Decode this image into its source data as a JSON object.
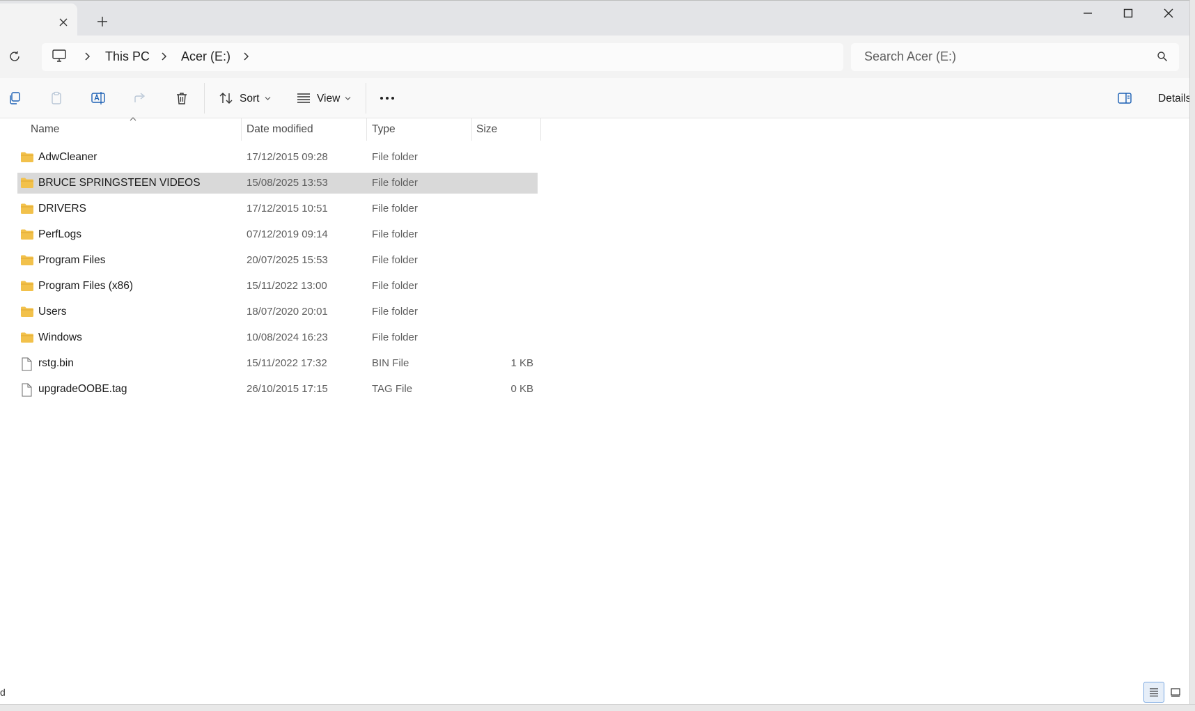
{
  "window": {
    "tab_close_icon": "close-icon",
    "new_tab_icon": "plus-icon",
    "minimize_icon": "minimize-icon",
    "maximize_icon": "maximize-icon",
    "close_icon": "close-icon"
  },
  "address": {
    "refresh_icon": "refresh-icon",
    "computer_icon": "computer-icon",
    "crumbs": [
      "This PC",
      "Acer (E:)"
    ],
    "search_placeholder": "Search Acer (E:)"
  },
  "toolbar": {
    "sort_label": "Sort",
    "view_label": "View",
    "details_label": "Details"
  },
  "columns": {
    "name": "Name",
    "date": "Date modified",
    "type": "Type",
    "size": "Size"
  },
  "files": [
    {
      "name": "AdwCleaner",
      "date": "17/12/2015 09:28",
      "type": "File folder",
      "size": "",
      "kind": "folder"
    },
    {
      "name": "BRUCE SPRINGSTEEN VIDEOS",
      "date": "15/08/2025 13:53",
      "type": "File folder",
      "size": "",
      "kind": "folder",
      "selected": true
    },
    {
      "name": "DRIVERS",
      "date": "17/12/2015 10:51",
      "type": "File folder",
      "size": "",
      "kind": "folder"
    },
    {
      "name": "PerfLogs",
      "date": "07/12/2019 09:14",
      "type": "File folder",
      "size": "",
      "kind": "folder"
    },
    {
      "name": "Program Files",
      "date": "20/07/2025 15:53",
      "type": "File folder",
      "size": "",
      "kind": "folder"
    },
    {
      "name": "Program Files (x86)",
      "date": "15/11/2022 13:00",
      "type": "File folder",
      "size": "",
      "kind": "folder"
    },
    {
      "name": "Users",
      "date": "18/07/2020 20:01",
      "type": "File folder",
      "size": "",
      "kind": "folder"
    },
    {
      "name": "Windows",
      "date": "10/08/2024 16:23",
      "type": "File folder",
      "size": "",
      "kind": "folder"
    },
    {
      "name": "rstg.bin",
      "date": "15/11/2022 17:32",
      "type": "BIN File",
      "size": "1 KB",
      "kind": "file"
    },
    {
      "name": "upgradeOOBE.tag",
      "date": "26/10/2015 17:15",
      "type": "TAG File",
      "size": "0 KB",
      "kind": "file"
    }
  ],
  "status": {
    "fragment": "d"
  },
  "colors": {
    "folder": "#f2c14b",
    "selected_row": "#d9d9d9",
    "accent": "#0067c0"
  }
}
